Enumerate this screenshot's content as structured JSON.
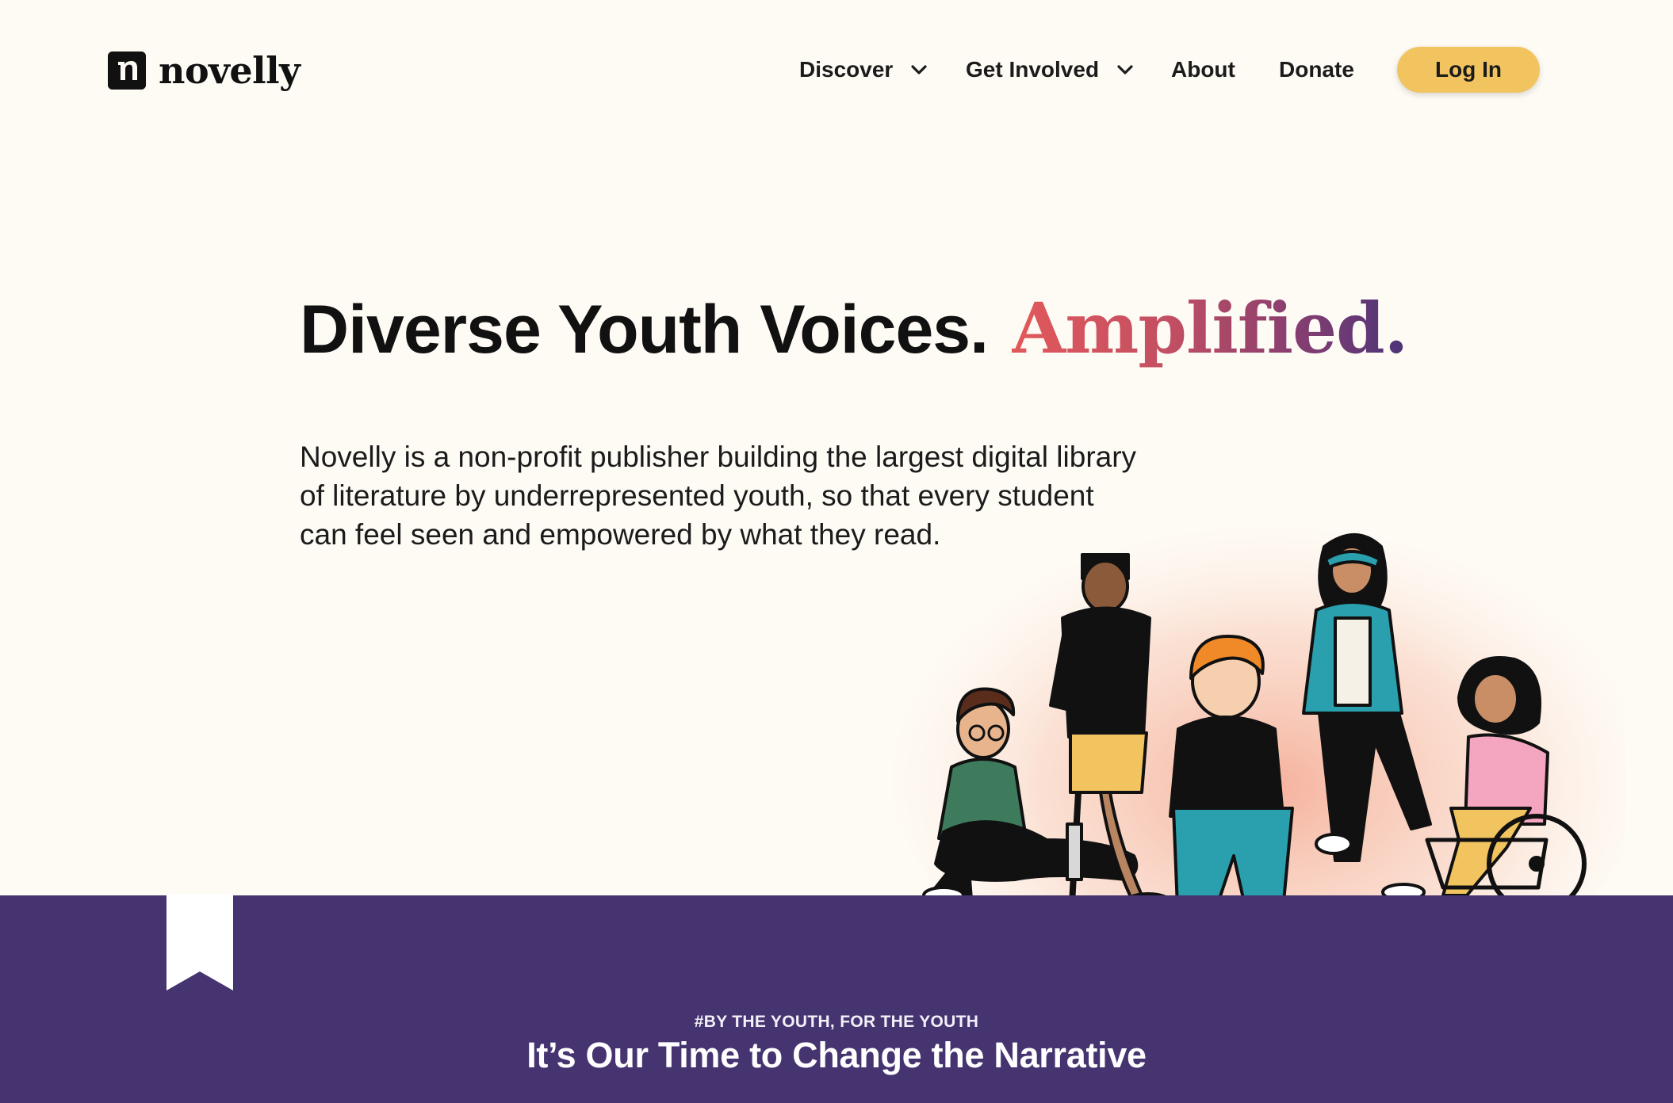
{
  "brand": {
    "name": "novelly",
    "mark_letter": "n"
  },
  "nav": {
    "items": [
      {
        "label": "Discover",
        "has_dropdown": true
      },
      {
        "label": "Get Involved",
        "has_dropdown": true
      },
      {
        "label": "About",
        "has_dropdown": false
      },
      {
        "label": "Donate",
        "has_dropdown": false
      }
    ],
    "login_label": "Log In"
  },
  "hero": {
    "title": "Diverse Youth Voices.",
    "title_accent": "Amplified.",
    "description": "Novelly is a non-profit publisher building the largest digital library of literature by underrepresented youth, so that every student can feel seen and empowered by what they read."
  },
  "banner": {
    "kicker": "#BY THE YOUTH, FOR THE YOUTH",
    "heading": "It’s Our Time to Change the Narrative"
  },
  "colors": {
    "background": "#fefbf5",
    "login_button": "#f2c45f",
    "banner": "#45346f",
    "accent_gradient_start": "#e2595a",
    "accent_gradient_end": "#4b3478"
  },
  "icons": {
    "dropdown": "chevron-down-icon",
    "bookmark": "bookmark-icon"
  }
}
